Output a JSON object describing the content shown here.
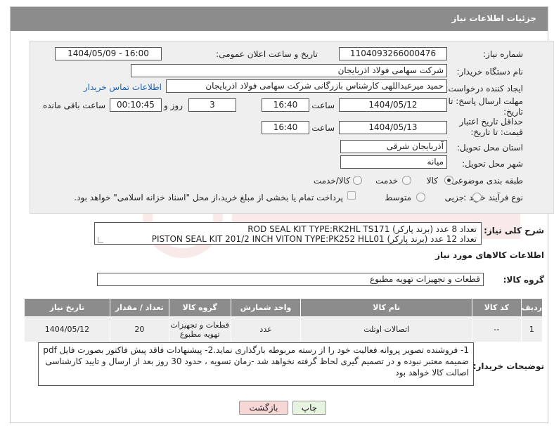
{
  "header": {
    "title": "جزئیات اطلاعات نیاز"
  },
  "fields": {
    "need_number": {
      "label": "شماره نیاز:",
      "value": "1104093266000476"
    },
    "announce_datetime": {
      "label": "تاریخ و ساعت اعلان عمومی:",
      "value": "1404/05/09 - 16:00"
    },
    "buyer_org": {
      "label": "نام دستگاه خریدار:",
      "value": "شرکت سهامی فولاد اذربایجان"
    },
    "requester": {
      "label": "ایجاد کننده درخواست:",
      "value": "حمید میرعبداللهی کارشناس بازرگانی شرکت سهامی فولاد اذربایجان",
      "contact_link": "اطلاعات تماس خریدار"
    },
    "deadline": {
      "label": "مهلت ارسال پاسخ: تا تاریخ:",
      "date": "1404/05/12",
      "time_label": "ساعت",
      "time": "16:40",
      "days": "3",
      "days_label": "روز و",
      "remaining": "00:10:45",
      "remaining_label": "ساعت باقی مانده"
    },
    "price_validity": {
      "label": "حداقل تاریخ اعتبار قیمت: تا تاریخ:",
      "date": "1404/05/13",
      "time_label": "ساعت",
      "time": "16:40"
    },
    "delivery_province": {
      "label": "استان محل تحویل:",
      "value": "آذربایجان شرقی"
    },
    "delivery_city": {
      "label": "شهر محل تحویل:",
      "value": "میانه"
    },
    "category": {
      "label": "طبقه بندی موضوعی:",
      "options": [
        "کالا",
        "خدمت",
        "کالا/خدمت"
      ],
      "selected": "کالا"
    },
    "process_type": {
      "label": "نوع فرآیند خرید :",
      "options": [
        "جزیی",
        "متوسط"
      ],
      "payment_note": "پرداخت تمام یا بخشی از مبلغ خرید،از محل \"اسناد خزانه اسلامی\" خواهد بود."
    }
  },
  "summary": {
    "label": "شرح کلی نیاز:",
    "line1": "ROD SEAL KIT TYPE:RK2HL TS171  تعداد 8 عدد (برند پارکر)",
    "line2": "PISTON SEAL KIT 201/2 INCH VITON TYPE:PK252 HLL01  (برند پارکر) تعداد 12 عدد"
  },
  "items_section": {
    "title": "اطلاعات کالاهای مورد نیاز",
    "group_label": "گروه کالا:",
    "group_value": "قطعات و تجهیزات تهویه مطبوع"
  },
  "table": {
    "headers": [
      "ردیف",
      "کد کالا",
      "نام کالا",
      "واحد شمارش",
      "گروه کالا",
      "تعداد / مقدار",
      "تاریخ نیاز"
    ],
    "rows": [
      [
        "1",
        "--",
        "اتصالات اوتلت",
        "عدد",
        "قطعات و تجهیزات تهویه مطبوع",
        "20",
        "1404/05/12"
      ]
    ]
  },
  "notes": {
    "label": "توضیحات خریدار:",
    "text": "1- فروشنده تصویر پروانه فعالیت خود را از رسته مربوطه بارگذاری نماید.2- پیشنهادات فاقد پیش فاکتور بصورت فایل pdf ضمیمه معتبر نبوده و در تصمیم گیری لحاظ گرفته نخواهد شد -زمان تسویه ، حدود 30 روز بعد از ارسال و تایید کارشناسی اصالت کالا خواهد بود"
  },
  "buttons": {
    "print": "چاپ",
    "back": "بازگشت"
  },
  "colors": {
    "header_bg": "#8c8c8c",
    "panel_bg": "#efefef",
    "link": "#1a5fb4",
    "back_btn_bg": "#f7d6d6",
    "print_btn_bg": "#e6f3df"
  }
}
